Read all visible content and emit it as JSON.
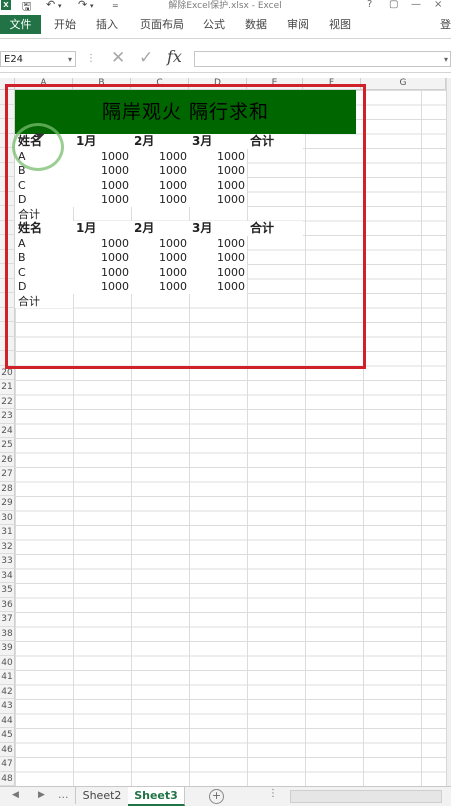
{
  "window": {
    "title": "解除Excel保护.xlsx - Excel",
    "controls": [
      "?",
      "▢",
      "—",
      "×"
    ]
  },
  "quick_access": {
    "excel_icon": "excel-icon",
    "save_icon": "save-icon",
    "undo_icon": "undo-icon",
    "redo_icon": "redo-icon"
  },
  "ribbon": {
    "file_tab": "文件",
    "tabs": [
      "开始",
      "插入",
      "页面布局",
      "公式",
      "数据",
      "审阅",
      "视图"
    ],
    "signin": "登"
  },
  "formula_bar": {
    "name_box": "E24",
    "formula": ""
  },
  "grid": {
    "columns": [
      "A",
      "B",
      "C",
      "D",
      "E",
      "F",
      "G"
    ],
    "visible_row_numbers": [
      "20",
      "21",
      "22",
      "23",
      "24",
      "25",
      "26",
      "27",
      "28",
      "29",
      "30",
      "31",
      "32",
      "33",
      "34",
      "35",
      "36",
      "37",
      "38",
      "39",
      "40",
      "41",
      "42",
      "43",
      "44",
      "45",
      "46",
      "47",
      "48"
    ]
  },
  "sheet": {
    "title_banner": "隔岸观火  隔行求和",
    "table1": {
      "headers": [
        "姓名",
        "1月",
        "2月",
        "3月",
        "合计"
      ],
      "rows": [
        {
          "name": "A",
          "m1": "1000",
          "m2": "1000",
          "m3": "1000",
          "total": ""
        },
        {
          "name": "B",
          "m1": "1000",
          "m2": "1000",
          "m3": "1000",
          "total": ""
        },
        {
          "name": "C",
          "m1": "1000",
          "m2": "1000",
          "m3": "1000",
          "total": ""
        },
        {
          "name": "D",
          "m1": "1000",
          "m2": "1000",
          "m3": "1000",
          "total": ""
        }
      ],
      "total_label": "合计"
    },
    "table2": {
      "headers": [
        "姓名",
        "1月",
        "2月",
        "3月",
        "合计"
      ],
      "rows": [
        {
          "name": "A",
          "m1": "1000",
          "m2": "1000",
          "m3": "1000",
          "total": ""
        },
        {
          "name": "B",
          "m1": "1000",
          "m2": "1000",
          "m3": "1000",
          "total": ""
        },
        {
          "name": "C",
          "m1": "1000",
          "m2": "1000",
          "m3": "1000",
          "total": ""
        },
        {
          "name": "D",
          "m1": "1000",
          "m2": "1000",
          "m3": "1000",
          "total": ""
        }
      ],
      "total_label": "合计"
    }
  },
  "sheet_tabs": {
    "more": "...",
    "tabs": [
      "Sheet2",
      "Sheet3"
    ],
    "active": "Sheet3",
    "add_label": "+"
  },
  "colors": {
    "excel_green": "#217346",
    "banner_fill": "#006600",
    "highlight_box": "#d0202a"
  }
}
